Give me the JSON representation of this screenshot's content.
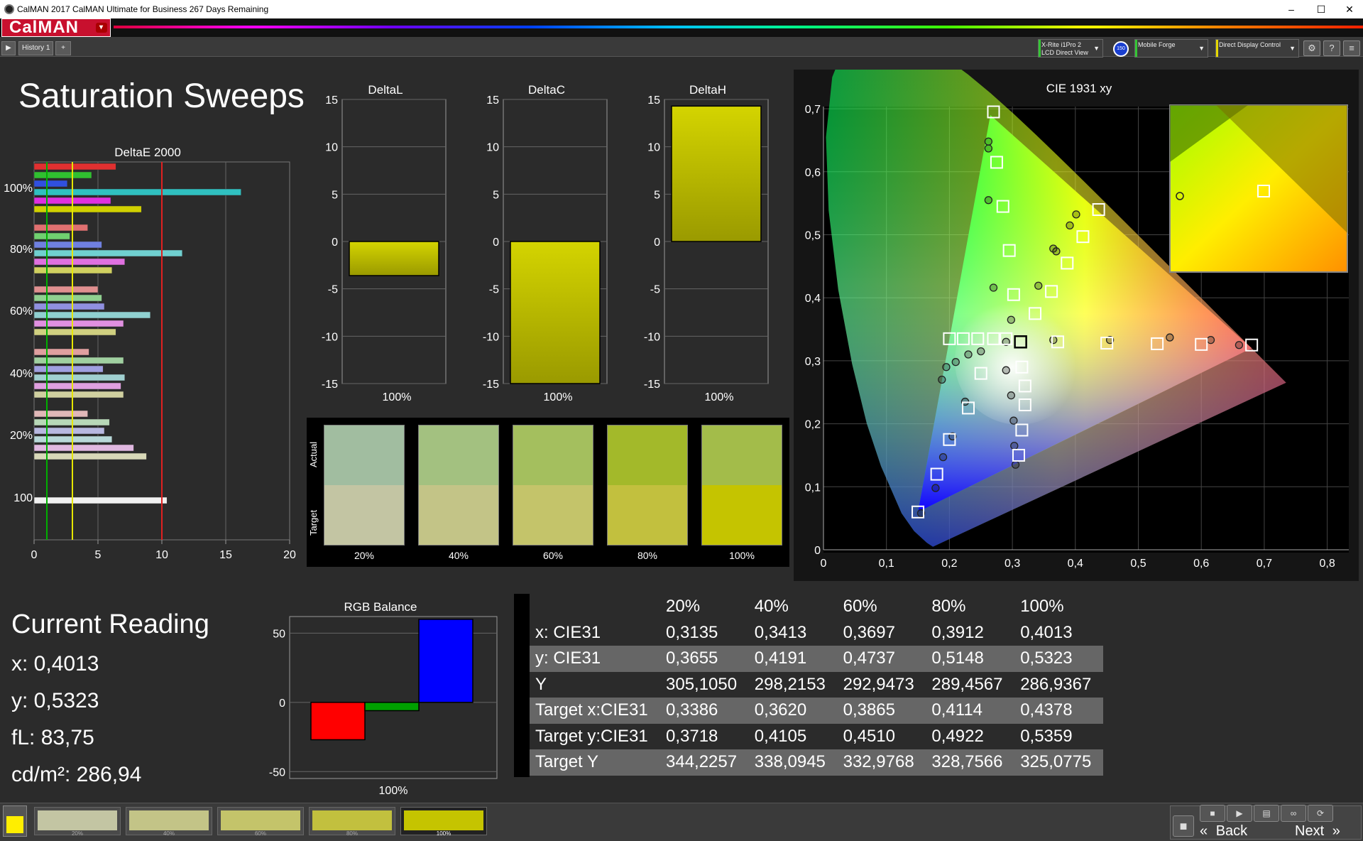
{
  "window": {
    "title": "CalMAN 2017 CalMAN Ultimate for Business 267 Days Remaining",
    "minimize": "–",
    "maximize": "☐",
    "close": "✕"
  },
  "logo": {
    "text": "CalMAN",
    "dropdown": "▾"
  },
  "tabs": {
    "play": "▶",
    "history": "History 1",
    "add": "+"
  },
  "devices": [
    {
      "line1": "X-Rite i1Pro 2",
      "line2": "LCD Direct View",
      "color": "#34c634"
    },
    {
      "line1": "Mobile Forge",
      "line2": "",
      "color": "#34c634"
    },
    {
      "line1": "Direct Display Control",
      "line2": "",
      "color": "#e6d800"
    }
  ],
  "device_badge": "150",
  "toolbar": {
    "settings": "⚙",
    "help": "?",
    "menu": "≡"
  },
  "page_title": "Saturation Sweeps",
  "deltae_chart": {
    "title": "DeltaE 2000",
    "xticks": [
      "0",
      "5",
      "10",
      "15",
      "20"
    ],
    "xlim": [
      0,
      20
    ],
    "ylabels": [
      "100%",
      "80%",
      "60%",
      "40%",
      "20%",
      "100"
    ],
    "ref_lines": [
      {
        "value": 1,
        "color": "#00b000"
      },
      {
        "value": 3,
        "color": "#e6e600"
      },
      {
        "value": 10,
        "color": "#e02020"
      }
    ]
  },
  "chart_data": [
    {
      "type": "bar",
      "title": "DeltaE 2000",
      "orientation": "horizontal",
      "xlim": [
        0,
        20
      ],
      "groups": [
        {
          "label": "100%",
          "values": [
            6.4,
            4.5,
            2.6,
            16.2,
            6.0,
            8.4
          ],
          "colors": [
            "#e03030",
            "#30c030",
            "#3050e0",
            "#30c0c0",
            "#e030e0",
            "#d0d000"
          ]
        },
        {
          "label": "80%",
          "values": [
            4.2,
            2.8,
            5.3,
            11.6,
            7.1,
            6.1
          ],
          "colors": [
            "#e07070",
            "#70d070",
            "#7080e0",
            "#70d0d0",
            "#e070e0",
            "#d0d060"
          ]
        },
        {
          "label": "60%",
          "values": [
            5.0,
            5.3,
            5.5,
            9.1,
            7.0,
            6.4
          ],
          "colors": [
            "#e09090",
            "#90d090",
            "#9090e0",
            "#90d0d0",
            "#e090e0",
            "#d0d080"
          ]
        },
        {
          "label": "40%",
          "values": [
            4.3,
            7.0,
            5.4,
            7.1,
            6.8,
            7.0
          ],
          "colors": [
            "#e0a0a0",
            "#a0d0a0",
            "#a0a0e0",
            "#a0d0d0",
            "#e0a0e0",
            "#d0d0a0"
          ]
        },
        {
          "label": "20%",
          "values": [
            4.2,
            5.9,
            5.5,
            6.1,
            7.8,
            8.8
          ],
          "colors": [
            "#e0b8b8",
            "#b8d8b8",
            "#b8b8e0",
            "#b8d8d8",
            "#e0b8e0",
            "#d8d8b8"
          ]
        },
        {
          "label": "100",
          "values": [
            10.4
          ],
          "colors": [
            "#f0f0f0"
          ]
        }
      ]
    },
    {
      "type": "bar",
      "title": "DeltaL",
      "categories": [
        "100%"
      ],
      "values": [
        -3.6
      ],
      "ylim": [
        -15,
        15
      ]
    },
    {
      "type": "bar",
      "title": "DeltaC",
      "categories": [
        "100%"
      ],
      "values": [
        -15
      ],
      "ylim": [
        -15,
        15
      ]
    },
    {
      "type": "bar",
      "title": "DeltaH",
      "categories": [
        "100%"
      ],
      "values": [
        14.3
      ],
      "ylim": [
        -15,
        15
      ]
    },
    {
      "type": "bar",
      "title": "RGB Balance",
      "categories": [
        "100%"
      ],
      "series": [
        {
          "values": [
            -27
          ],
          "color": "#ff0000"
        },
        {
          "values": [
            -6
          ],
          "color": "#00a000"
        },
        {
          "values": [
            60
          ],
          "color": "#0000ff"
        }
      ],
      "ylim": [
        -55,
        62
      ],
      "yticks": [
        "50",
        "0",
        "-50"
      ]
    },
    {
      "type": "scatter",
      "title": "CIE 1931 xy",
      "xlim": [
        0,
        0.85
      ],
      "ylim": [
        0,
        0.85
      ],
      "xticks": [
        "0",
        "0,1",
        "0,2",
        "0,3",
        "0,4",
        "0,5",
        "0,6",
        "0,7",
        "0,8"
      ],
      "yticks": [
        "0",
        "0,1",
        "0,2",
        "0,3",
        "0,4",
        "0,5",
        "0,6",
        "0,7",
        "0,8"
      ],
      "targets": [
        [
          0.15,
          0.06
        ],
        [
          0.18,
          0.12
        ],
        [
          0.2,
          0.175
        ],
        [
          0.23,
          0.225
        ],
        [
          0.25,
          0.28
        ],
        [
          0.27,
          0.695
        ],
        [
          0.275,
          0.615
        ],
        [
          0.285,
          0.545
        ],
        [
          0.295,
          0.475
        ],
        [
          0.302,
          0.405
        ],
        [
          0.336,
          0.375
        ],
        [
          0.362,
          0.41
        ],
        [
          0.387,
          0.455
        ],
        [
          0.412,
          0.497
        ],
        [
          0.437,
          0.54
        ],
        [
          0.372,
          0.33
        ],
        [
          0.45,
          0.328
        ],
        [
          0.53,
          0.327
        ],
        [
          0.6,
          0.326
        ],
        [
          0.68,
          0.325
        ],
        [
          0.31,
          0.15
        ],
        [
          0.315,
          0.19
        ],
        [
          0.32,
          0.23
        ],
        [
          0.32,
          0.26
        ],
        [
          0.315,
          0.29
        ],
        [
          0.2,
          0.335
        ],
        [
          0.222,
          0.335
        ],
        [
          0.245,
          0.335
        ],
        [
          0.27,
          0.335
        ],
        [
          0.29,
          0.335
        ],
        [
          0.313,
          0.33
        ]
      ],
      "actuals": [
        [
          0.155,
          0.058
        ],
        [
          0.178,
          0.098
        ],
        [
          0.19,
          0.147
        ],
        [
          0.205,
          0.18
        ],
        [
          0.225,
          0.235
        ],
        [
          0.262,
          0.648
        ],
        [
          0.262,
          0.637
        ],
        [
          0.262,
          0.555
        ],
        [
          0.27,
          0.416
        ],
        [
          0.298,
          0.365
        ],
        [
          0.3413,
          0.4191
        ],
        [
          0.3697,
          0.4737
        ],
        [
          0.3912,
          0.5148
        ],
        [
          0.4013,
          0.5323
        ],
        [
          0.365,
          0.478
        ],
        [
          0.365,
          0.333
        ],
        [
          0.455,
          0.333
        ],
        [
          0.55,
          0.337
        ],
        [
          0.615,
          0.333
        ],
        [
          0.66,
          0.325
        ],
        [
          0.305,
          0.135
        ],
        [
          0.303,
          0.165
        ],
        [
          0.302,
          0.205
        ],
        [
          0.298,
          0.245
        ],
        [
          0.29,
          0.285
        ],
        [
          0.188,
          0.27
        ],
        [
          0.195,
          0.29
        ],
        [
          0.21,
          0.298
        ],
        [
          0.23,
          0.31
        ],
        [
          0.25,
          0.315
        ],
        [
          0.29,
          0.33
        ]
      ],
      "current_point": [
        0.313,
        0.33
      ],
      "inset": {
        "target": [
          0.4378,
          0.5359
        ],
        "actual": [
          0.4013,
          0.5323
        ]
      }
    }
  ],
  "delta_charts": {
    "ticks": [
      "15",
      "10",
      "5",
      "0",
      "-5",
      "-10",
      "-15"
    ],
    "xlabel": "100%"
  },
  "swatches": {
    "actual_label": "Actual",
    "target_label": "Target",
    "items": [
      {
        "label": "20%",
        "actual": "#a1bda0",
        "target": "#c3c5a3"
      },
      {
        "label": "40%",
        "actual": "#a3c180",
        "target": "#c3c487"
      },
      {
        "label": "60%",
        "actual": "#a4bf5e",
        "target": "#c4c46a"
      },
      {
        "label": "80%",
        "actual": "#a3b92a",
        "target": "#c2c03e"
      },
      {
        "label": "100%",
        "actual": "#a3bc4a",
        "target": "#c5c400"
      }
    ]
  },
  "current_reading": {
    "title": "Current Reading",
    "x": "x: 0,4013",
    "y": "y: 0,5323",
    "fl": "fL: 83,75",
    "cdm2": "cd/m²: 286,94"
  },
  "rgb_balance": {
    "title": "RGB Balance",
    "xlabel": "100%"
  },
  "cie": {
    "title": "CIE 1931 xy"
  },
  "table": {
    "headers": [
      "",
      "20%",
      "40%",
      "60%",
      "80%",
      "100%"
    ],
    "rows": [
      [
        "x: CIE31",
        "0,3135",
        "0,3413",
        "0,3697",
        "0,3912",
        "0,4013"
      ],
      [
        "y: CIE31",
        "0,3655",
        "0,4191",
        "0,4737",
        "0,5148",
        "0,5323"
      ],
      [
        "Y",
        "305,1050",
        "298,2153",
        "292,9473",
        "289,4567",
        "286,9367"
      ],
      [
        "Target x:CIE31",
        "0,3386",
        "0,3620",
        "0,3865",
        "0,4114",
        "0,4378"
      ],
      [
        "Target y:CIE31",
        "0,3718",
        "0,4105",
        "0,4510",
        "0,4922",
        "0,5359"
      ],
      [
        "Target Y",
        "344,2257",
        "338,0945",
        "332,9768",
        "328,7566",
        "325,0775"
      ]
    ]
  },
  "bottom": {
    "thumbs": [
      {
        "label": "20%",
        "color": "#c3c5a3"
      },
      {
        "label": "40%",
        "color": "#c3c487"
      },
      {
        "label": "60%",
        "color": "#c4c46a"
      },
      {
        "label": "80%",
        "color": "#c2c03e"
      },
      {
        "label": "100%",
        "color": "#c5c400"
      }
    ],
    "back": "Back",
    "next": "Next",
    "back_arrow": "«",
    "next_arrow": "»"
  }
}
